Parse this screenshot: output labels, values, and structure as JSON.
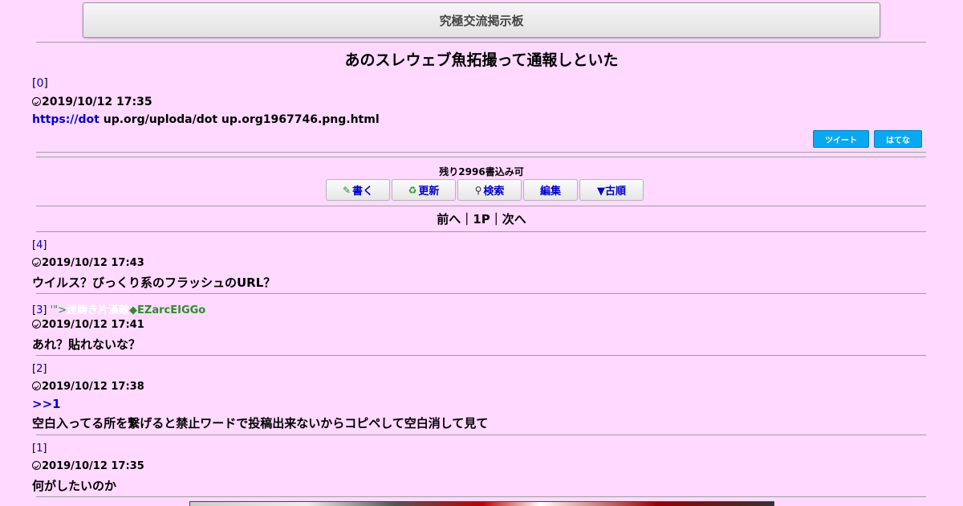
{
  "header": {
    "title": "究極交流掲示板"
  },
  "thread": {
    "title": "あのスレウェブ魚拓撮って通報しといた",
    "op": {
      "number": "0",
      "date": "2019/10/12 17:35",
      "link_text": "https://dot",
      "rest_text": " up.org/uploda/dot up.org1967746.png.html"
    }
  },
  "share": {
    "tweet": "ツイート",
    "hatena": "はてな"
  },
  "status": {
    "remaining": "残り2996書込み可"
  },
  "toolbar": {
    "write": "書く",
    "refresh": "更新",
    "search": "検索",
    "edit": "編集",
    "order": "▼古順"
  },
  "pager": {
    "prev": "前へ",
    "sep1": "｜",
    "page": "1P",
    "sep2": "｜",
    "next": "次へ"
  },
  "posts": [
    {
      "number": "4",
      "date": "2019/10/12 17:43",
      "body": "ウイルス？びっくり系のフラッシュのURL？"
    },
    {
      "number": "3",
      "name_prefix": "'\">",
      "name": "迷鋳き片漢敵",
      "trip_mark": "◆",
      "trip": "EZarcEIGGo",
      "date": "2019/10/12 17:41",
      "body": "あれ？貼れないな？"
    },
    {
      "number": "2",
      "date": "2019/10/12 17:38",
      "anchor": ">>1",
      "body": "空白入ってる所を繋げると禁止ワードで投稿出来ないからコピペして空白消して見て"
    },
    {
      "number": "1",
      "date": "2019/10/12 17:35",
      "body": "何がしたいのか"
    }
  ],
  "colors": {
    "background": "#ffd9ff",
    "link": "#0000cc",
    "share": "#0aa8ef",
    "trip": "#2e8b2e"
  }
}
